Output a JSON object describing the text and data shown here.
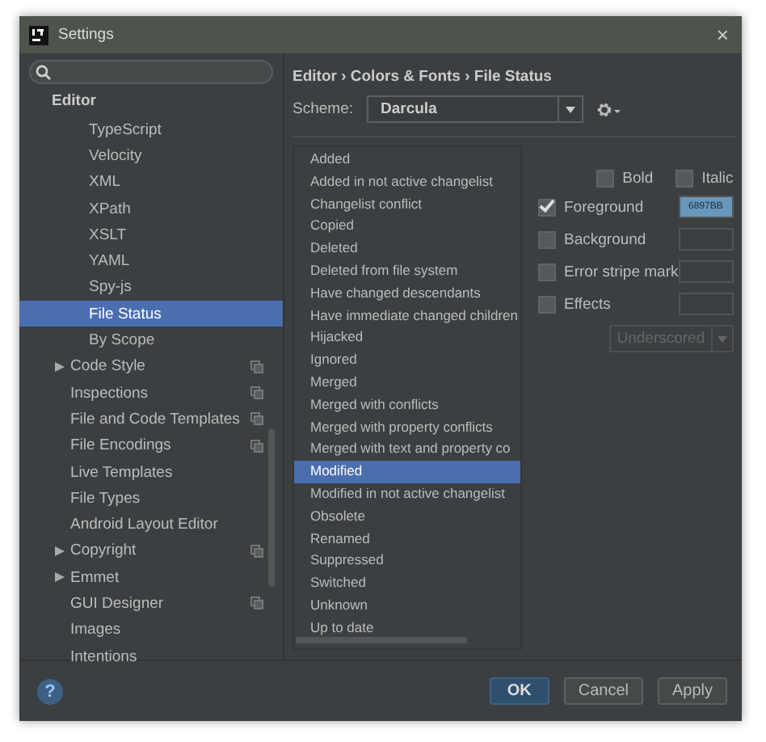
{
  "window": {
    "title": "Settings",
    "close": "×"
  },
  "sidebar": {
    "items": [
      {
        "label": "Editor",
        "children": [
          {
            "kind": "continued",
            "children": [
              {
                "label": "TypeScript",
                "selected": false
              },
              {
                "label": "Velocity",
                "selected": false
              },
              {
                "label": "XML",
                "selected": false
              },
              {
                "label": "XPath",
                "selected": false
              },
              {
                "label": "XSLT",
                "selected": false
              },
              {
                "label": "YAML",
                "selected": false
              },
              {
                "label": "Spy-js",
                "selected": false
              },
              {
                "label": "File Status",
                "selected": true
              },
              {
                "label": "By Scope",
                "selected": false
              }
            ]
          },
          {
            "label": "Code Style",
            "selected": false,
            "expanded": false,
            "project_icon": true
          },
          {
            "label": "Inspections",
            "selected": false,
            "project_icon": true
          },
          {
            "label": "File and Code Templates",
            "selected": false,
            "project_icon": true
          },
          {
            "label": "File Encodings",
            "selected": false,
            "project_icon": true
          },
          {
            "label": "Live Templates",
            "selected": false
          },
          {
            "label": "File Types",
            "selected": false
          },
          {
            "label": "Android Layout Editor",
            "selected": false
          },
          {
            "label": "Copyright",
            "selected": false,
            "expanded": false,
            "project_icon": true
          },
          {
            "label": "Emmet",
            "selected": false,
            "expanded": false
          },
          {
            "label": "GUI Designer",
            "selected": false,
            "project_icon": true
          },
          {
            "label": "Images",
            "selected": false
          },
          {
            "label": "Intentions",
            "selected": false
          }
        ]
      }
    ]
  },
  "breadcrumb": "Editor › Colors & Fonts › File Status",
  "scheme": {
    "label": "Scheme:",
    "value": "Darcula"
  },
  "status_list": [
    {
      "label": "Added",
      "selected": false
    },
    {
      "label": "Added in not active changelist",
      "selected": false
    },
    {
      "label": "Changelist conflict",
      "selected": false
    },
    {
      "label": "Copied",
      "selected": false
    },
    {
      "label": "Deleted",
      "selected": false
    },
    {
      "label": "Deleted from file system",
      "selected": false
    },
    {
      "label": "Have changed descendants",
      "selected": false
    },
    {
      "label": "Have immediate changed children",
      "selected": false
    },
    {
      "label": "Hijacked",
      "selected": false
    },
    {
      "label": "Ignored",
      "selected": false
    },
    {
      "label": "Merged",
      "selected": false
    },
    {
      "label": "Merged with conflicts",
      "selected": false
    },
    {
      "label": "Merged with property conflicts",
      "selected": false
    },
    {
      "label": "Merged with text and property co",
      "selected": false
    },
    {
      "label": "Modified",
      "selected": true
    },
    {
      "label": "Modified in not active changelist",
      "selected": false
    },
    {
      "label": "Obsolete",
      "selected": false
    },
    {
      "label": "Renamed",
      "selected": false
    },
    {
      "label": "Suppressed",
      "selected": false
    },
    {
      "label": "Switched",
      "selected": false
    },
    {
      "label": "Unknown",
      "selected": false
    },
    {
      "label": "Up to date",
      "selected": false
    }
  ],
  "font_styles": [
    {
      "label": "Bold",
      "checked": false
    },
    {
      "label": "Italic",
      "checked": false
    }
  ],
  "attributes": [
    {
      "label": "Foreground",
      "checked": true,
      "value": "6897BB",
      "color": "#6897bb"
    },
    {
      "label": "Background",
      "checked": false
    },
    {
      "label": "Error stripe mark",
      "checked": false
    },
    {
      "label": "Effects",
      "checked": false
    }
  ],
  "effect_type": {
    "value": "Underscored",
    "disabled": true
  },
  "help": "?",
  "buttons": [
    {
      "label": "OK",
      "kind": "default"
    },
    {
      "label": "Cancel",
      "kind": "normal"
    },
    {
      "label": "Apply",
      "kind": "normal"
    }
  ]
}
